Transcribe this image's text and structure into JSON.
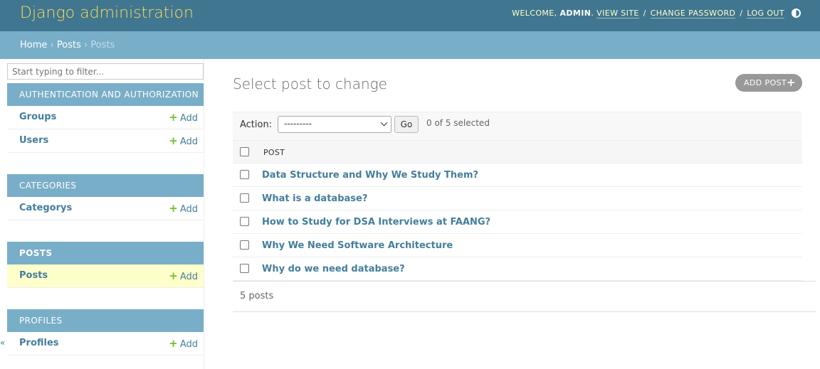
{
  "header": {
    "brand": "Django administration",
    "welcome": "WELCOME,",
    "username": "ADMIN",
    "view_site": "VIEW SITE",
    "change_password": "CHANGE PASSWORD",
    "log_out": "LOG OUT",
    "separator": "/",
    "theme_icon": "theme-toggle-icon"
  },
  "breadcrumbs": {
    "home": "Home",
    "app": "Posts",
    "current": "Posts",
    "separator": "›"
  },
  "sidebar": {
    "filter_placeholder": "Start typing to filter...",
    "add_label": "Add",
    "collapse_glyph": "«",
    "modules": [
      {
        "caption": "AUTHENTICATION AND AUTHORIZATION",
        "models": [
          "Groups",
          "Users"
        ]
      },
      {
        "caption": "CATEGORIES",
        "models": [
          "Categorys"
        ]
      },
      {
        "caption": "POSTS",
        "models": [
          "Posts"
        ]
      },
      {
        "caption": "PROFILES",
        "models": [
          "Profiles"
        ]
      }
    ]
  },
  "main": {
    "title": "Select post to change",
    "add_button": "ADD POST",
    "add_icon": "plus-icon",
    "action_label": "Action:",
    "action_selected": "---------",
    "go_button": "Go",
    "selection_counter": "0 of 5 selected",
    "column_header": "POST",
    "rows": [
      "Data Structure and Why We Study Them?",
      "What is a database?",
      "How to Study for DSA Interviews at FAANG?",
      "Why We Need Software Architecture",
      "Why do we need database?"
    ],
    "paginator": "5 posts"
  },
  "colors": {
    "header_bg": "#417690",
    "brand": "#f5dd5d",
    "breadcrumbs_bg": "#79aec8",
    "module_caption_bg": "#79aec8",
    "link": "#447e9b",
    "add_plus": "#70bf2b",
    "current_row_bg": "#ffffcc"
  }
}
